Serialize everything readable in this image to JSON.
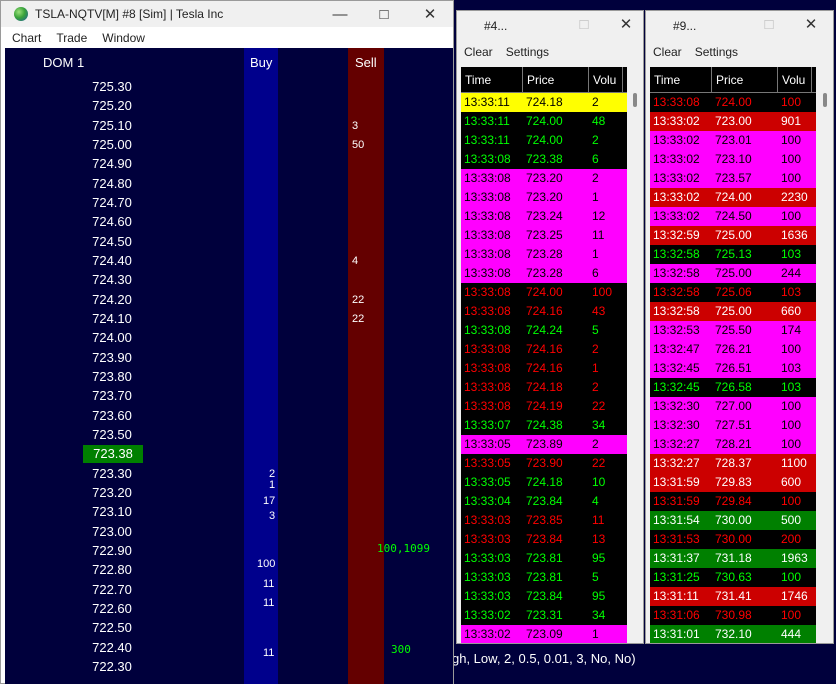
{
  "dom_window": {
    "title": "TSLA-NQTV[M]  #8 [Sim]  | Tesla Inc",
    "menu": [
      "Chart",
      "Trade",
      "Window"
    ],
    "heading": "DOM 1",
    "buy_label": "Buy",
    "sell_label": "Sell",
    "prices": [
      "725.30",
      "725.20",
      "725.10",
      "725.00",
      "724.90",
      "724.80",
      "724.70",
      "724.60",
      "724.50",
      "724.40",
      "724.30",
      "724.20",
      "724.10",
      "724.00",
      "723.90",
      "723.80",
      "723.70",
      "723.60",
      "723.50",
      "723.38",
      "723.30",
      "723.20",
      "723.10",
      "723.00",
      "722.90",
      "722.80",
      "722.70",
      "722.60",
      "722.50",
      "722.40",
      "722.30"
    ],
    "last_price_index": 19,
    "sell_qty": [
      {
        "row": 2,
        "text": "3"
      },
      {
        "row": 3,
        "text": "50"
      },
      {
        "row": 9,
        "text": "4"
      },
      {
        "row": 11,
        "text": "22"
      },
      {
        "row": 12,
        "text": "22"
      }
    ],
    "buy_qty": [
      {
        "row": 20,
        "text": "2"
      },
      {
        "row": 20.6,
        "text": "1"
      },
      {
        "row": 21.4,
        "text": "17"
      },
      {
        "row": 22.2,
        "text": "3"
      },
      {
        "row": 24.7,
        "text": "100"
      },
      {
        "row": 25.7,
        "text": "11"
      },
      {
        "row": 26.7,
        "text": "11"
      },
      {
        "row": 29.3,
        "text": "11"
      }
    ],
    "side_values": [
      {
        "row": 23.9,
        "text": "100,1099"
      },
      {
        "row": 29.1,
        "text": "300"
      }
    ]
  },
  "chart_status_text": "gh, Low, 2, 0.5, 0.01, 3, No, No)",
  "colors": {
    "yellow": "#ffff00",
    "magenta": "#ff00ff",
    "red": "#cc0000",
    "green": "#008000",
    "black": "#000000",
    "text_green": "#00ff00",
    "text_red": "#ff0000",
    "text_black": "#000000",
    "text_white": "#ffffff"
  },
  "ts_windows": [
    {
      "title": "#4...",
      "menu": [
        "Clear",
        "Settings"
      ],
      "columns": [
        "Time",
        "Price",
        "Volu"
      ],
      "rows": [
        [
          "13:33:11",
          "724.18",
          "2",
          "yellow"
        ],
        [
          "13:33:11",
          "724.00",
          "48",
          "black"
        ],
        [
          "13:33:11",
          "724.00",
          "2",
          "black"
        ],
        [
          "13:33:08",
          "723.38",
          "6",
          "black"
        ],
        [
          "13:33:08",
          "723.20",
          "2",
          "magenta"
        ],
        [
          "13:33:08",
          "723.20",
          "1",
          "magenta"
        ],
        [
          "13:33:08",
          "723.24",
          "12",
          "magenta"
        ],
        [
          "13:33:08",
          "723.25",
          "11",
          "magenta"
        ],
        [
          "13:33:08",
          "723.28",
          "1",
          "magenta"
        ],
        [
          "13:33:08",
          "723.28",
          "6",
          "magenta"
        ],
        [
          "13:33:08",
          "724.00",
          "100",
          "black-red"
        ],
        [
          "13:33:08",
          "724.16",
          "43",
          "black-red"
        ],
        [
          "13:33:08",
          "724.24",
          "5",
          "black"
        ],
        [
          "13:33:08",
          "724.16",
          "2",
          "black-red"
        ],
        [
          "13:33:08",
          "724.16",
          "1",
          "black-red"
        ],
        [
          "13:33:08",
          "724.18",
          "2",
          "black-red"
        ],
        [
          "13:33:08",
          "724.19",
          "22",
          "black-red"
        ],
        [
          "13:33:07",
          "724.38",
          "34",
          "black"
        ],
        [
          "13:33:05",
          "723.89",
          "2",
          "magenta"
        ],
        [
          "13:33:05",
          "723.90",
          "22",
          "black-red"
        ],
        [
          "13:33:05",
          "724.18",
          "10",
          "black"
        ],
        [
          "13:33:04",
          "723.84",
          "4",
          "black"
        ],
        [
          "13:33:03",
          "723.85",
          "11",
          "black-red"
        ],
        [
          "13:33:03",
          "723.84",
          "13",
          "black-red"
        ],
        [
          "13:33:03",
          "723.81",
          "95",
          "black"
        ],
        [
          "13:33:03",
          "723.81",
          "5",
          "black"
        ],
        [
          "13:33:03",
          "723.84",
          "95",
          "black"
        ],
        [
          "13:33:02",
          "723.31",
          "34",
          "black"
        ],
        [
          "13:33:02",
          "723.09",
          "1",
          "magenta"
        ]
      ]
    },
    {
      "title": "#9...",
      "menu": [
        "Clear",
        "Settings"
      ],
      "columns": [
        "Time",
        "Price",
        "Volu"
      ],
      "rows": [
        [
          "13:33:08",
          "724.00",
          "100",
          "black-red"
        ],
        [
          "13:33:02",
          "723.00",
          "901",
          "red"
        ],
        [
          "13:33:02",
          "723.01",
          "100",
          "magenta"
        ],
        [
          "13:33:02",
          "723.10",
          "100",
          "magenta"
        ],
        [
          "13:33:02",
          "723.57",
          "100",
          "magenta"
        ],
        [
          "13:33:02",
          "724.00",
          "2230",
          "red"
        ],
        [
          "13:33:02",
          "724.50",
          "100",
          "magenta"
        ],
        [
          "13:32:59",
          "725.00",
          "1636",
          "red"
        ],
        [
          "13:32:58",
          "725.13",
          "103",
          "black"
        ],
        [
          "13:32:58",
          "725.00",
          "244",
          "magenta"
        ],
        [
          "13:32:58",
          "725.06",
          "103",
          "black-red"
        ],
        [
          "13:32:58",
          "725.00",
          "660",
          "red"
        ],
        [
          "13:32:53",
          "725.50",
          "174",
          "magenta"
        ],
        [
          "13:32:47",
          "726.21",
          "100",
          "magenta"
        ],
        [
          "13:32:45",
          "726.51",
          "103",
          "magenta"
        ],
        [
          "13:32:45",
          "726.58",
          "103",
          "black"
        ],
        [
          "13:32:30",
          "727.00",
          "100",
          "magenta"
        ],
        [
          "13:32:30",
          "727.51",
          "100",
          "magenta"
        ],
        [
          "13:32:27",
          "728.21",
          "100",
          "magenta"
        ],
        [
          "13:32:27",
          "728.37",
          "1100",
          "red"
        ],
        [
          "13:31:59",
          "729.83",
          "600",
          "red"
        ],
        [
          "13:31:59",
          "729.84",
          "100",
          "black-red"
        ],
        [
          "13:31:54",
          "730.00",
          "500",
          "green"
        ],
        [
          "13:31:53",
          "730.00",
          "200",
          "black-red"
        ],
        [
          "13:31:37",
          "731.18",
          "1963",
          "green"
        ],
        [
          "13:31:25",
          "730.63",
          "100",
          "black"
        ],
        [
          "13:31:11",
          "731.41",
          "1746",
          "red"
        ],
        [
          "13:31:06",
          "730.98",
          "100",
          "black-red"
        ],
        [
          "13:31:01",
          "732.10",
          "444",
          "green"
        ]
      ]
    }
  ]
}
